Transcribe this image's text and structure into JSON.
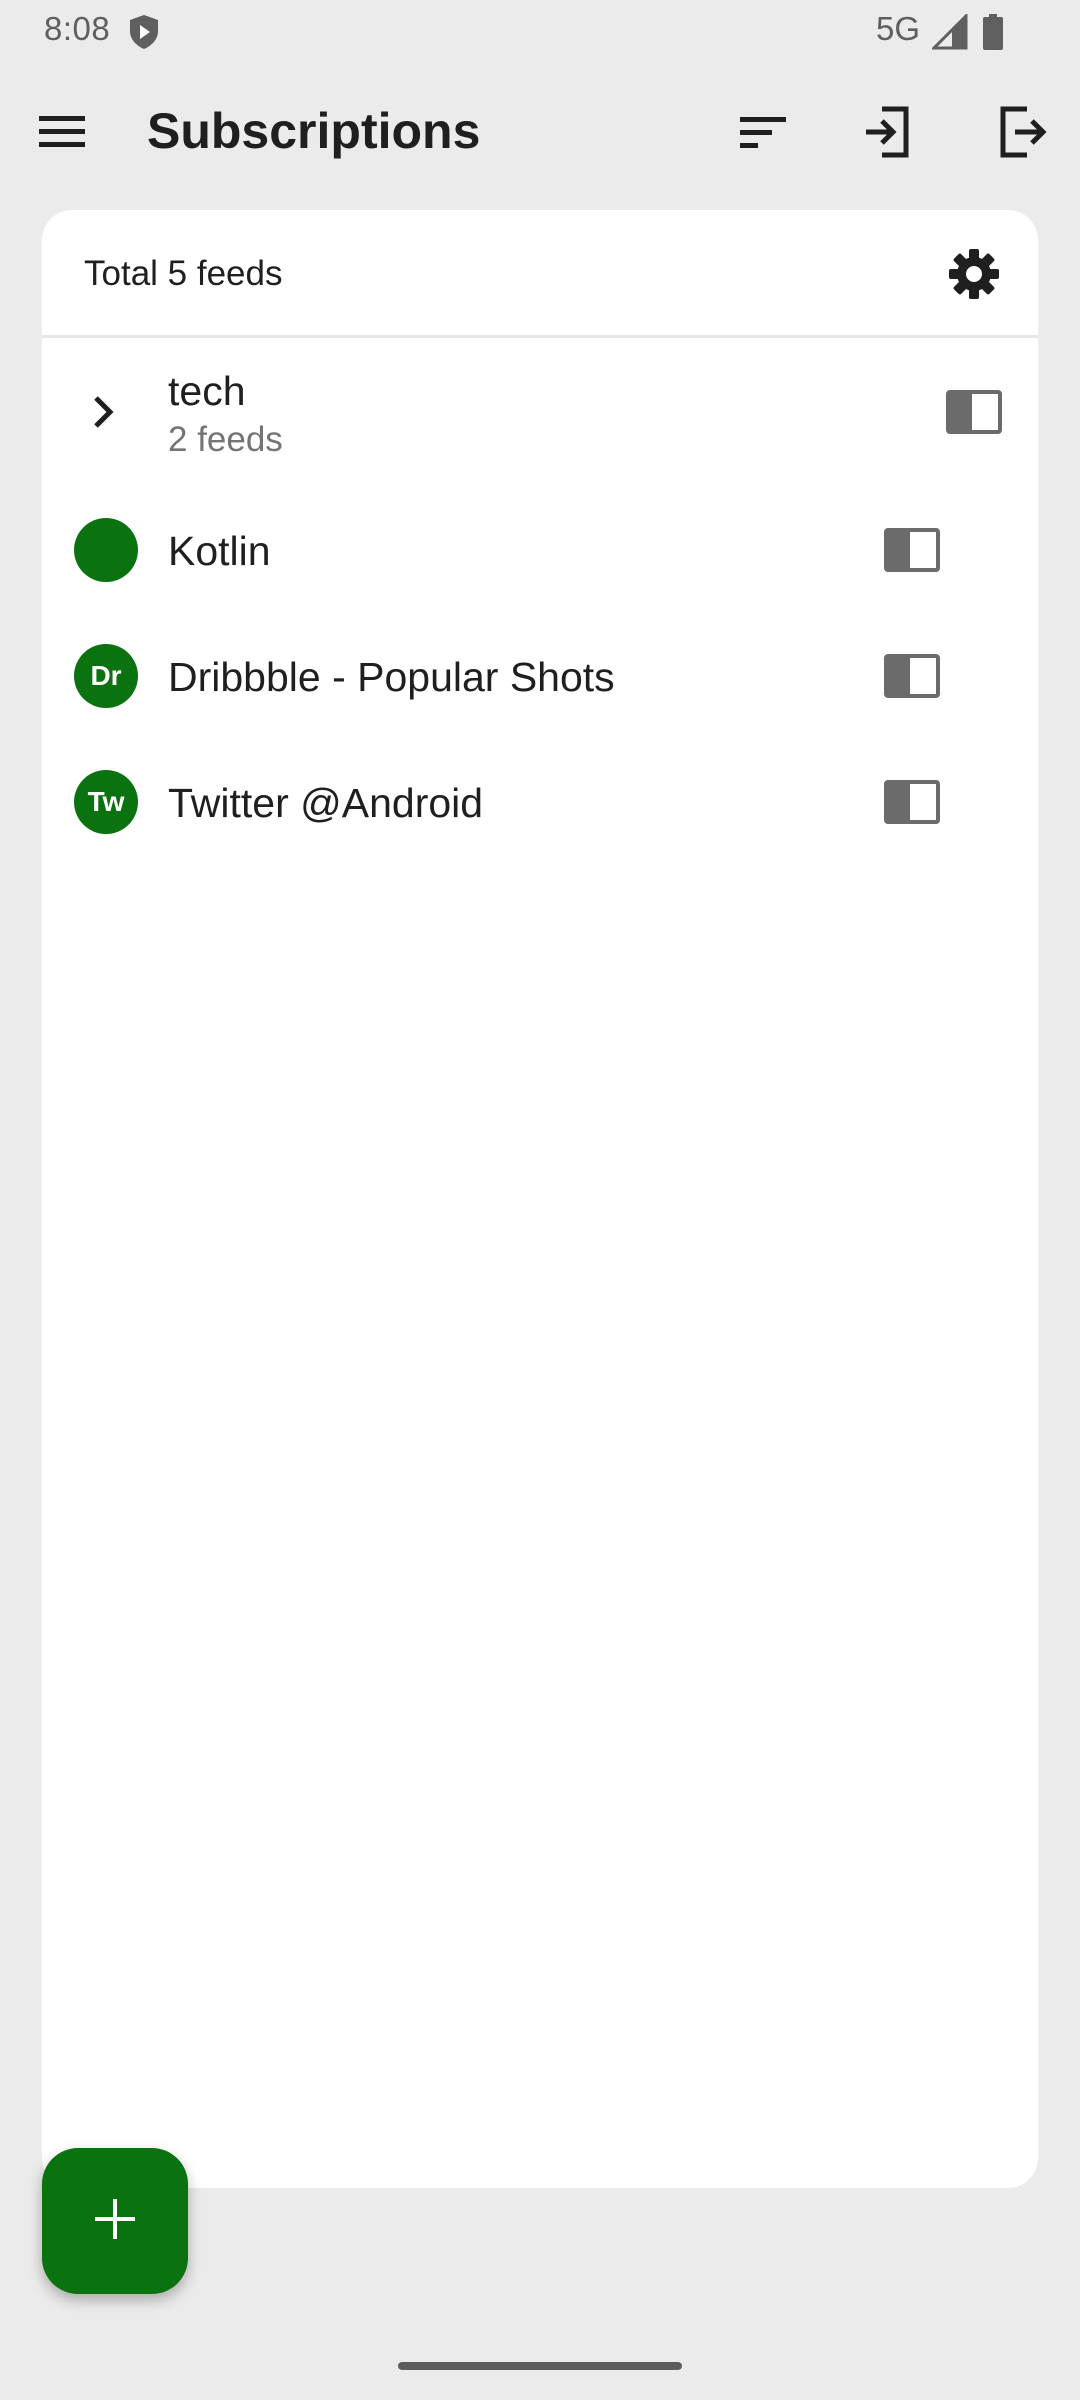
{
  "status_bar": {
    "time": "8:08",
    "network": "5G",
    "shield_icon": "shield-play-icon",
    "signal_icon": "signal-icon",
    "battery_icon": "battery-icon"
  },
  "toolbar": {
    "title": "Subscriptions",
    "menu_icon": "menu-icon",
    "sort_icon": "sort-icon",
    "import_icon": "import-icon",
    "export_icon": "export-icon"
  },
  "card": {
    "total_label": "Total 5 feeds",
    "settings_icon": "gear-icon"
  },
  "group": {
    "name": "tech",
    "count": "2 feeds",
    "expand_icon": "chevron-right-icon"
  },
  "feeds": [
    {
      "title": "Kotlin",
      "avatar_text": ""
    },
    {
      "title": "Dribbble - Popular Shots",
      "avatar_text": "Dr"
    },
    {
      "title": "Twitter @Android",
      "avatar_text": "Tw"
    }
  ],
  "fab": {
    "icon": "plus-icon"
  },
  "colors": {
    "accent": "#0a7310",
    "background": "#ebebeb",
    "card": "#ffffff",
    "icon_gray": "#6b6b6b"
  }
}
